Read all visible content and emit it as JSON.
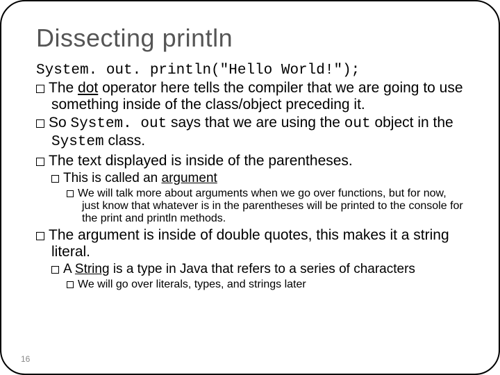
{
  "title": "Dissecting println",
  "code_line": "System. out. println(\"Hello World!\");",
  "b1_pre": "The ",
  "b1_dot": "dot",
  "b1_post": " operator here tells the compiler that we are going to use something inside of the class/object preceding it.",
  "b2_pre": "So ",
  "b2_code1": "System. out",
  "b2_mid": " says that we are using the ",
  "b2_code2": "out",
  "b2_mid2": " object in the ",
  "b2_code3": "System",
  "b2_post": " class.",
  "b3": "The text displayed is inside of the parentheses.",
  "b3a_pre": "This is called an ",
  "b3a_arg": "argument",
  "b3a1": "We will talk more about arguments when we go over functions, but for now, just know that whatever is in the parentheses will be printed to the console for the print and println methods.",
  "b4": "The argument is inside of double quotes, this makes it a string literal.",
  "b4a_pre": "A ",
  "b4a_str": "String",
  "b4a_post": " is a type in Java that refers to a series of characters",
  "b4a1": "We will go over literals, types, and strings later",
  "pagenum": "16"
}
